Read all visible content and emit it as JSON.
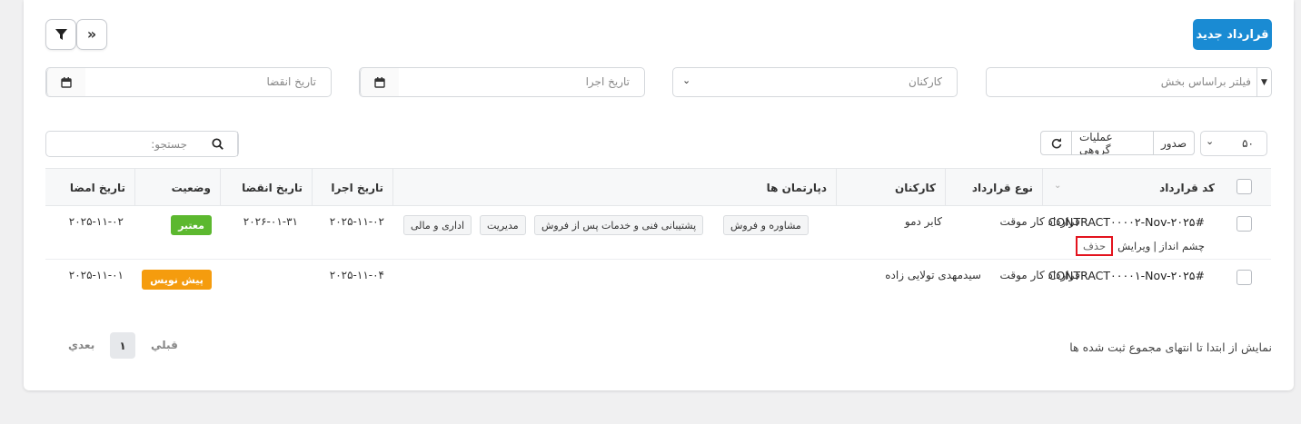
{
  "header": {
    "new_contract": "قرارداد جدید"
  },
  "filters": {
    "section_placeholder": "فیلتر براساس بخش",
    "employees_placeholder": "کارکنان",
    "exec_date_placeholder": "تاریخ اجرا",
    "expire_date_placeholder": "تاریخ انقضا"
  },
  "toolbar": {
    "page_size": "۵۰",
    "export_label": "صدور",
    "bulk_label": "عملیات گروهی",
    "search_placeholder": "جستجو:"
  },
  "table": {
    "headers": {
      "code": "کد قرارداد",
      "type": "نوع قرارداد",
      "employees": "کارکنان",
      "departments": "دپارتمان ها",
      "exec_date": "تاریخ اجرا",
      "expire_date": "تاریخ انقضا",
      "status": "وضعیت",
      "sign_date": "تاریخ امضا"
    },
    "rows": [
      {
        "code": "CONTRACT۰۰۰۰۲-Nov-۲۰۲۵#",
        "actions": {
          "view": "چشم انداز",
          "sep": "|",
          "edit": "ویرایش",
          "delete": "حذف"
        },
        "type": "قرارداد کار موقت",
        "employees": "کابر دمو",
        "departments": [
          "مشاوره و فروش",
          "پشتیبانی فنی و خدمات پس از فروش",
          "مدیریت",
          "اداری و مالی"
        ],
        "exec_date": "۲۰۲۵-۱۱-۰۲",
        "expire_date": "۲۰۲۶-۰۱-۳۱",
        "status": "معتبر",
        "sign_date": "۲۰۲۵-۱۱-۰۲"
      },
      {
        "code": "CONTRACT۰۰۰۰۱-Nov-۲۰۲۵#",
        "type": "قرارداد کار موقت",
        "employees": "سیدمهدی تولایی زاده",
        "exec_date": "۲۰۲۵-۱۱-۰۴",
        "expire_date": "",
        "status": "پیش نویس",
        "sign_date": "۲۰۲۵-۱۱-۰۱"
      }
    ]
  },
  "footer": {
    "info": "نمایش از ابتدا تا انتهای مجموع ثبت شده ها",
    "prev": "قبلي",
    "page": "۱",
    "next": "بعدي"
  },
  "colors": {
    "primary": "#1a8bd3",
    "valid": "#5cb82f",
    "draft": "#f59c0e",
    "highlight": "#e3131e"
  }
}
